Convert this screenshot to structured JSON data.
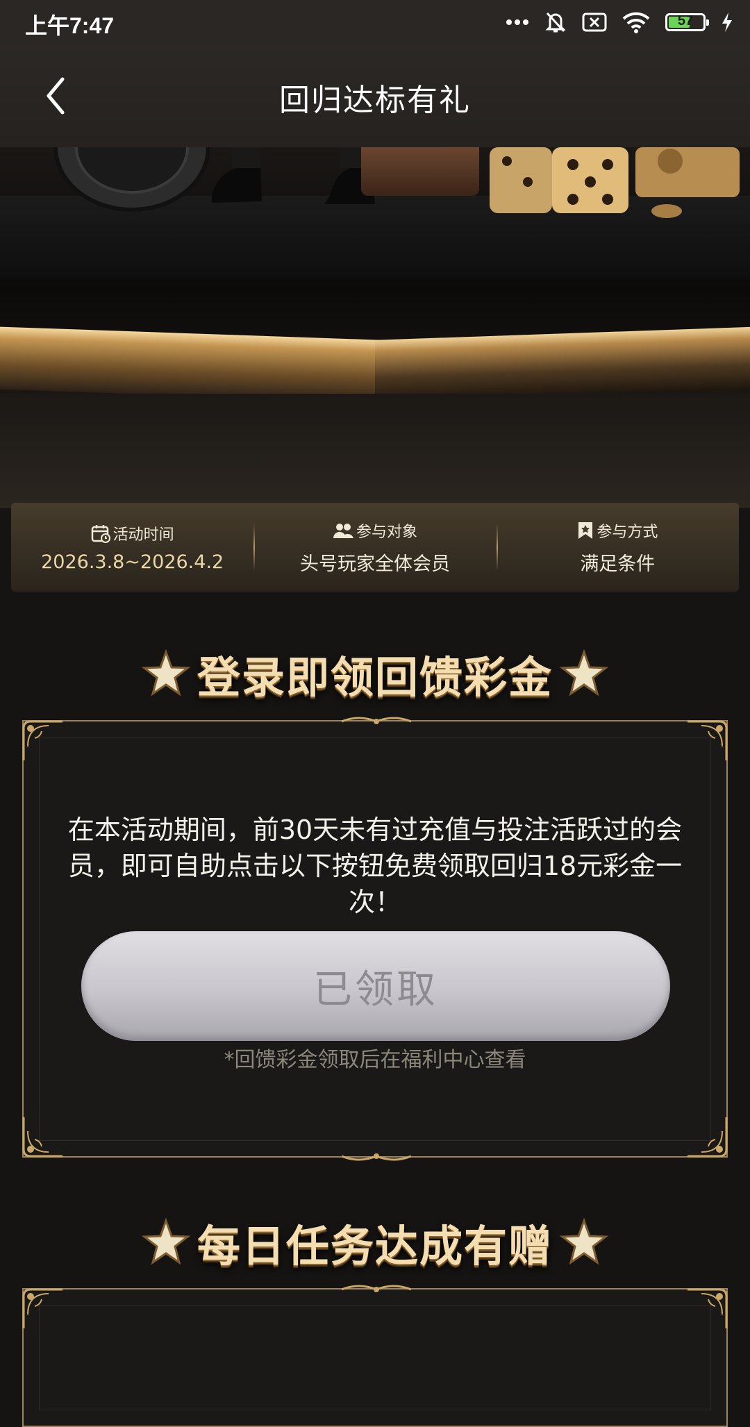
{
  "status_bar": {
    "time": "上午7:47",
    "battery_level": "57",
    "icons": [
      "more-dots-icon",
      "bell-off-icon",
      "sim-off-icon",
      "wifi-icon",
      "battery-icon",
      "charging-icon"
    ]
  },
  "nav": {
    "title": "回归达标有礼"
  },
  "info": {
    "time_label": "活动时间",
    "time_value": "2026.3.8~2026.4.2",
    "target_label": "参与对象",
    "target_value": "头号玩家全体会员",
    "method_label": "参与方式",
    "method_value": "满足条件"
  },
  "section1": {
    "title": "登录即领回馈彩金",
    "description": "在本活动期间，前30天未有过充值与投注活跃过的会员，即可自助点击以下按钮免费领取回归18元彩金一次！",
    "button_label": "已领取",
    "note": "*回馈彩金领取后在福利中心查看"
  },
  "section2": {
    "title": "每日任务达成有赠"
  },
  "colors": {
    "accent_gold": "#e9d7a8",
    "battery_green": "#6bd35a",
    "background": "#161412"
  }
}
